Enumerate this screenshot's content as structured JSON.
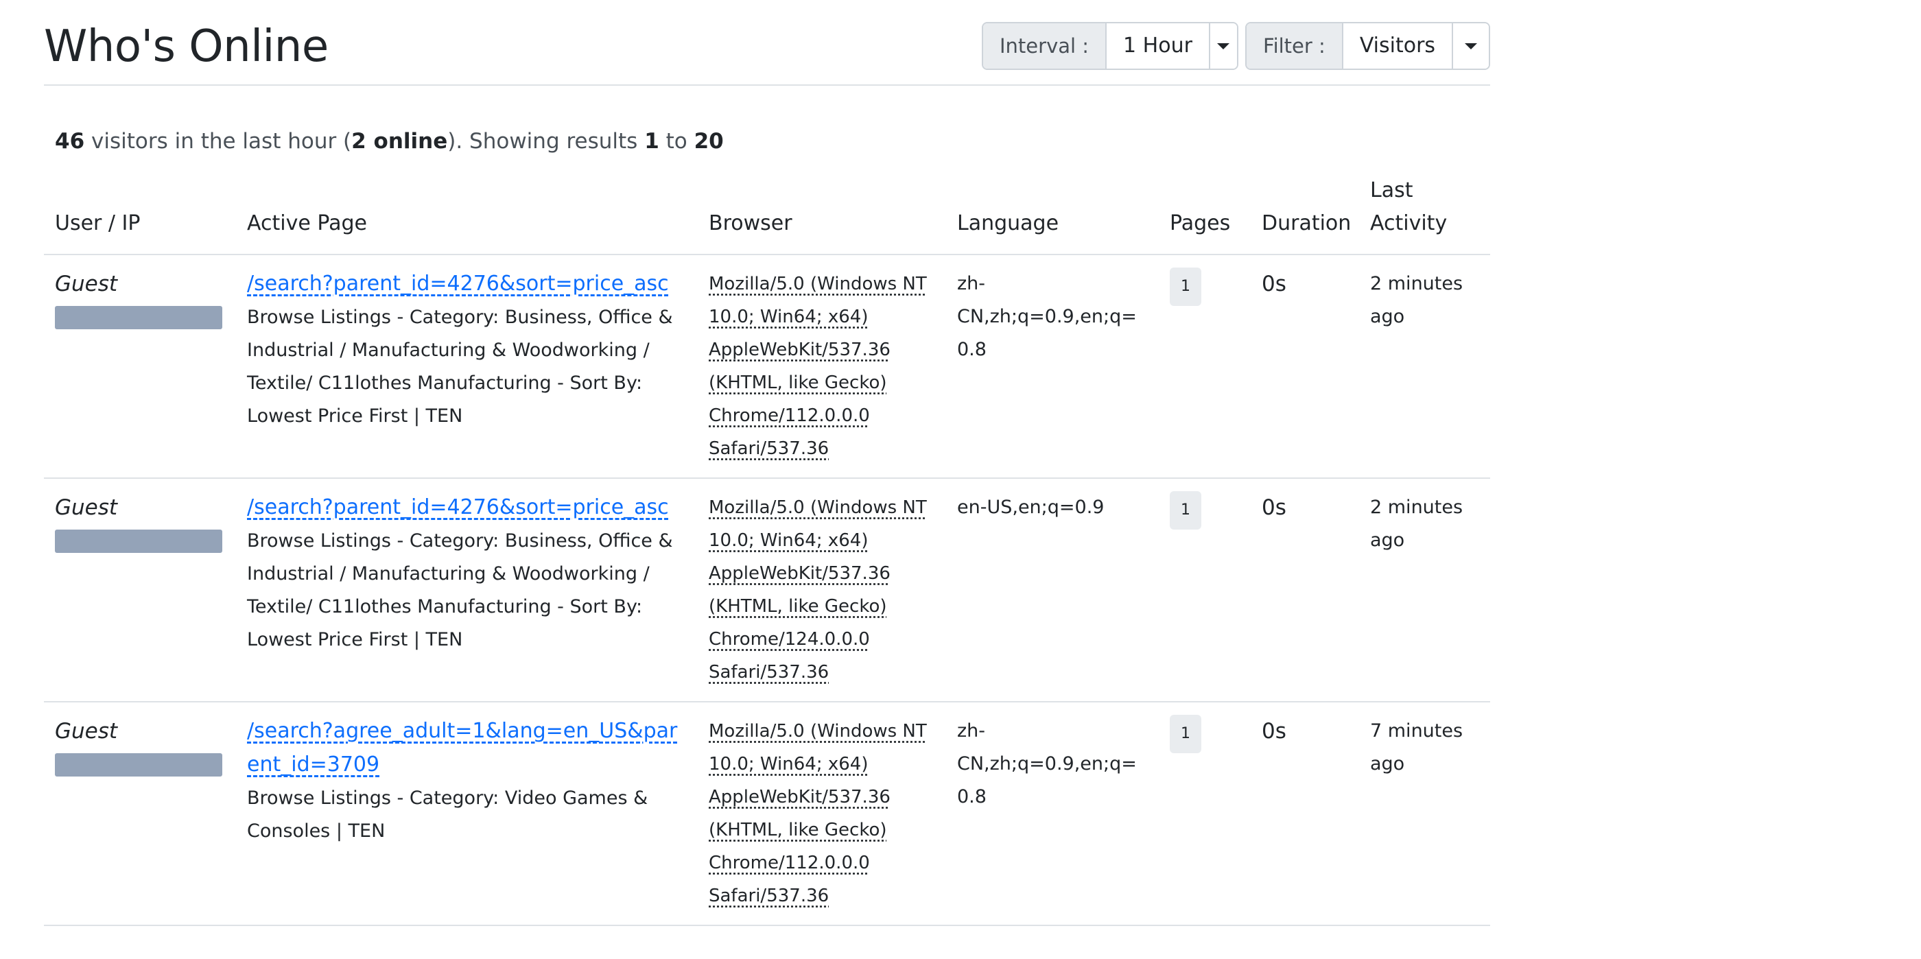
{
  "header": {
    "title": "Who's Online",
    "interval": {
      "label": "Interval :",
      "value": "1 Hour"
    },
    "filter": {
      "label": "Filter :",
      "value": "Visitors"
    }
  },
  "summary": {
    "visitors_count": "46",
    "text_visitors": " visitors in the last hour (",
    "online_count": "2 online",
    "text_showing": "). Showing results ",
    "from": "1",
    "text_to": " to ",
    "to": "20"
  },
  "table": {
    "columns": {
      "user": "User / IP",
      "page": "Active Page",
      "browser": "Browser",
      "language": "Language",
      "pages": "Pages",
      "duration": "Duration",
      "activity": "Last Activity"
    },
    "rows": [
      {
        "user": "Guest",
        "url": "/search?parent_id=4276&sort=price_asc",
        "description": "Browse Listings - Category: Business, Office & Industrial / Manufacturing & Woodworking / Textile/ C11lothes Manufacturing - Sort By: Lowest Price First | TEN",
        "browser": "Mozilla/5.0 (Windows NT 10.0; Win64; x64) AppleWebKit/537.36 (KHTML, like Gecko) Chrome/112.0.0.0 Safari/537.36",
        "language": "zh-CN,zh;q=0.9,en;q=0.8",
        "pages": "1",
        "duration": "0s",
        "activity": "2 minutes ago"
      },
      {
        "user": "Guest",
        "url": "/search?parent_id=4276&sort=price_asc",
        "description": "Browse Listings - Category: Business, Office & Industrial / Manufacturing & Woodworking / Textile/ C11lothes Manufacturing - Sort By: Lowest Price First | TEN",
        "browser": "Mozilla/5.0 (Windows NT 10.0; Win64; x64) AppleWebKit/537.36 (KHTML, like Gecko) Chrome/124.0.0.0 Safari/537.36",
        "language": "en-US,en;q=0.9",
        "pages": "1",
        "duration": "0s",
        "activity": "2 minutes ago"
      },
      {
        "user": "Guest",
        "url": "/search?agree_adult=1&lang=en_US&parent_id=3709",
        "description": "Browse Listings - Category: Video Games & Consoles | TEN",
        "browser": "Mozilla/5.0 (Windows NT 10.0; Win64; x64) AppleWebKit/537.36 (KHTML, like Gecko) Chrome/112.0.0.0 Safari/537.36",
        "language": "zh-CN,zh;q=0.9,en;q=0.8",
        "pages": "1",
        "duration": "0s",
        "activity": "7 minutes ago"
      }
    ]
  }
}
